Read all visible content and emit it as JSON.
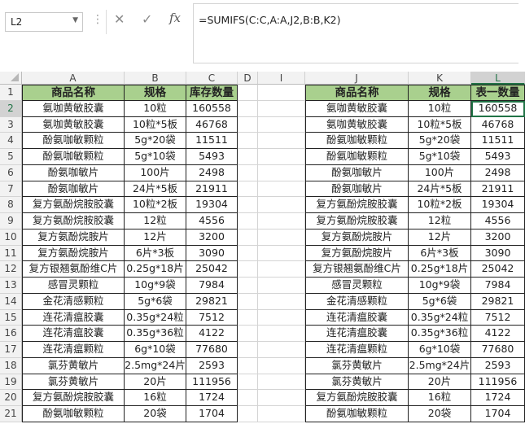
{
  "formula_bar": {
    "name_box": "L2",
    "formula": "=SUMIFS(C:C,A:A,J2,B:B,K2)"
  },
  "icons": {
    "cancel": "x-icon",
    "enter": "check-icon",
    "function": "fx-icon",
    "dropdown": "chevron-down-icon",
    "dots": "more-dots-icon"
  },
  "columns": [
    "A",
    "B",
    "C",
    "D",
    "I",
    "J",
    "K",
    "L"
  ],
  "row_numbers": [
    "1",
    "2",
    "3",
    "4",
    "5",
    "6",
    "7",
    "8",
    "9",
    "10",
    "11",
    "12",
    "13",
    "14",
    "15",
    "16",
    "17",
    "18",
    "19",
    "20",
    "21"
  ],
  "header_color": "#a9d08e",
  "selection_color": "#217346",
  "left_table": {
    "headers": [
      "商品名称",
      "规格",
      "库存数量"
    ],
    "rows": [
      [
        "氨咖黄敏胶囊",
        "10粒",
        "160558"
      ],
      [
        "氨咖黄敏胶囊",
        "10粒*5板",
        "46768"
      ],
      [
        "酚氨咖敏颗粒",
        "5g*20袋",
        "11511"
      ],
      [
        "酚氨咖敏颗粒",
        "5g*10袋",
        "5493"
      ],
      [
        "酚氨咖敏片",
        "100片",
        "2498"
      ],
      [
        "酚氨咖敏片",
        "24片*5板",
        "21911"
      ],
      [
        "复方氨酚烷胺胶囊",
        "10粒*2板",
        "19304"
      ],
      [
        "复方氨酚烷胺胶囊",
        "12粒",
        "4556"
      ],
      [
        "复方氨酚烷胺片",
        "12片",
        "3200"
      ],
      [
        "复方氨酚烷胺片",
        "6片*3板",
        "3090"
      ],
      [
        "复方银翘氨酚维C片",
        "0.25g*18片",
        "25042"
      ],
      [
        "感冒灵颗粒",
        "10g*9袋",
        "7984"
      ],
      [
        "金花清感颗粒",
        "5g*6袋",
        "29821"
      ],
      [
        "连花清瘟胶囊",
        "0.35g*24粒",
        "7512"
      ],
      [
        "连花清瘟胶囊",
        "0.35g*36粒",
        "4122"
      ],
      [
        "连花清瘟颗粒",
        "6g*10袋",
        "77680"
      ],
      [
        "氯芬黄敏片",
        "2.5mg*24片",
        "2593"
      ],
      [
        "氯芬黄敏片",
        "20片",
        "111956"
      ],
      [
        "复方氨酚烷胺胶囊",
        "16粒",
        "1724"
      ],
      [
        "酚氨咖敏颗粒",
        "20袋",
        "1704"
      ]
    ]
  },
  "right_table": {
    "headers": [
      "商品名称",
      "规格",
      "表一数量"
    ],
    "rows": [
      [
        "氨咖黄敏胶囊",
        "10粒",
        "160558"
      ],
      [
        "氨咖黄敏胶囊",
        "10粒*5板",
        "46768"
      ],
      [
        "酚氨咖敏颗粒",
        "5g*20袋",
        "11511"
      ],
      [
        "酚氨咖敏颗粒",
        "5g*10袋",
        "5493"
      ],
      [
        "酚氨咖敏片",
        "100片",
        "2498"
      ],
      [
        "酚氨咖敏片",
        "24片*5板",
        "21911"
      ],
      [
        "复方氨酚烷胺胶囊",
        "10粒*2板",
        "19304"
      ],
      [
        "复方氨酚烷胺胶囊",
        "12粒",
        "4556"
      ],
      [
        "复方氨酚烷胺片",
        "12片",
        "3200"
      ],
      [
        "复方氨酚烷胺片",
        "6片*3板",
        "3090"
      ],
      [
        "复方银翘氨酚维C片",
        "0.25g*18片",
        "25042"
      ],
      [
        "感冒灵颗粒",
        "10g*9袋",
        "7984"
      ],
      [
        "金花清感颗粒",
        "5g*6袋",
        "29821"
      ],
      [
        "连花清瘟胶囊",
        "0.35g*24粒",
        "7512"
      ],
      [
        "连花清瘟胶囊",
        "0.35g*36粒",
        "4122"
      ],
      [
        "连花清瘟颗粒",
        "6g*10袋",
        "77680"
      ],
      [
        "氯芬黄敏片",
        "2.5mg*24片",
        "2593"
      ],
      [
        "氯芬黄敏片",
        "20片",
        "111956"
      ],
      [
        "复方氨酚烷胺胶囊",
        "16粒",
        "1724"
      ],
      [
        "酚氨咖敏颗粒",
        "20袋",
        "1704"
      ]
    ]
  }
}
